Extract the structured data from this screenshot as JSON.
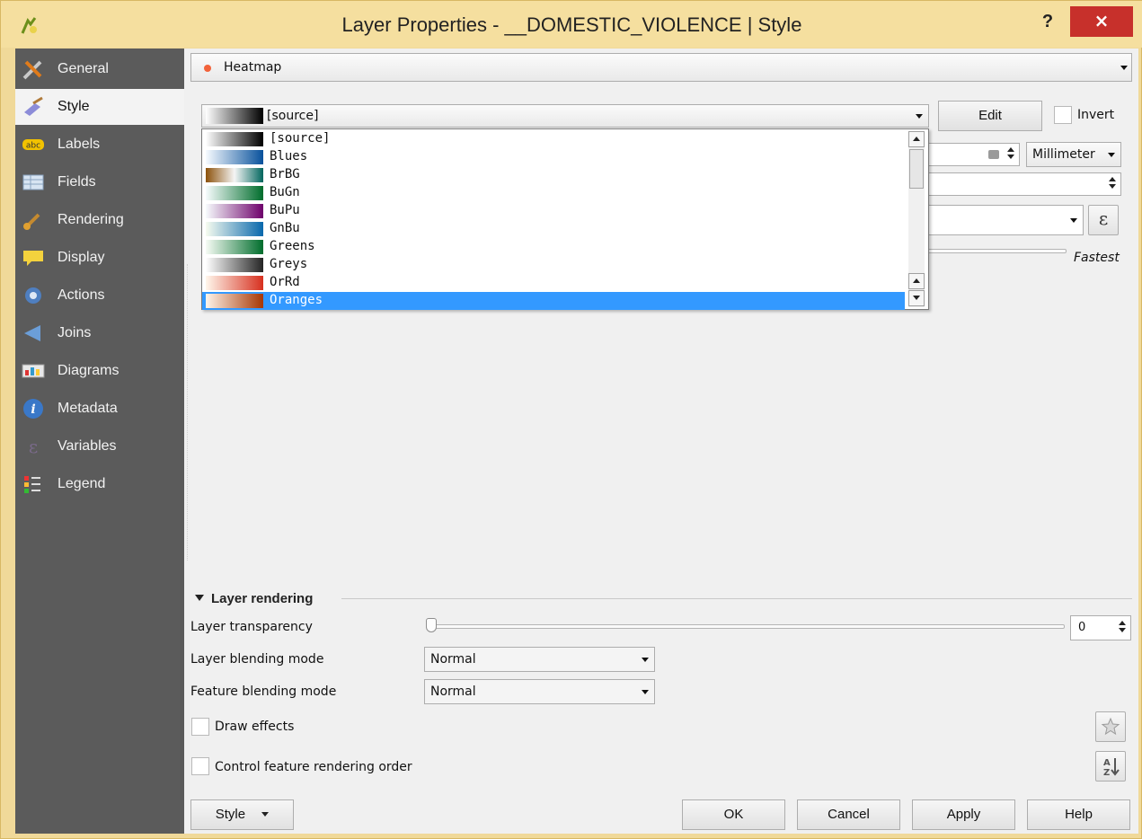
{
  "window": {
    "title": "Layer Properties - __DOMESTIC_VIOLENCE | Style",
    "help_label": "?",
    "close_label": "×",
    "accent": "#c7302b"
  },
  "sidebar": {
    "items": [
      {
        "label": "General",
        "icon": "general-icon"
      },
      {
        "label": "Style",
        "icon": "style-icon",
        "selected": true
      },
      {
        "label": "Labels",
        "icon": "labels-icon"
      },
      {
        "label": "Fields",
        "icon": "fields-icon"
      },
      {
        "label": "Rendering",
        "icon": "rendering-icon"
      },
      {
        "label": "Display",
        "icon": "display-icon"
      },
      {
        "label": "Actions",
        "icon": "actions-icon"
      },
      {
        "label": "Joins",
        "icon": "joins-icon"
      },
      {
        "label": "Diagrams",
        "icon": "diagrams-icon"
      },
      {
        "label": "Metadata",
        "icon": "metadata-icon"
      },
      {
        "label": "Variables",
        "icon": "variables-icon"
      },
      {
        "label": "Legend",
        "icon": "legend-icon"
      }
    ]
  },
  "renderer": {
    "type_label": "Heatmap",
    "color_ramp_value": "[source]",
    "edit_label": "Edit",
    "invert_label": "Invert",
    "unit_value": "Millimeter",
    "expression_symbol": "ε",
    "fastest_label": "Fastest"
  },
  "ramp_list": {
    "items": [
      {
        "label": "[source]",
        "colors": [
          "#ffffff",
          "#000000"
        ]
      },
      {
        "label": "Blues",
        "colors": [
          "#f7fbff",
          "#08519c"
        ]
      },
      {
        "label": "BrBG",
        "colors": [
          "#8c510a",
          "#f5f5f5",
          "#01665e"
        ]
      },
      {
        "label": "BuGn",
        "colors": [
          "#f7fcfd",
          "#006d2c"
        ]
      },
      {
        "label": "BuPu",
        "colors": [
          "#f7fcfd",
          "#6e016b"
        ]
      },
      {
        "label": "GnBu",
        "colors": [
          "#f7fcf0",
          "#0868ac"
        ]
      },
      {
        "label": "Greens",
        "colors": [
          "#f7fcf5",
          "#006d2c"
        ]
      },
      {
        "label": "Greys",
        "colors": [
          "#ffffff",
          "#252525"
        ]
      },
      {
        "label": "OrRd",
        "colors": [
          "#fff7ec",
          "#d7301f"
        ]
      },
      {
        "label": "Oranges",
        "colors": [
          "#fff5eb",
          "#a63603"
        ],
        "selected": true
      }
    ],
    "selection_color": "#3399ff"
  },
  "layer_rendering": {
    "section_label": "Layer rendering",
    "transparency_label": "Layer transparency",
    "transparency_value": "0",
    "layer_blend_label": "Layer blending mode",
    "layer_blend_value": "Normal",
    "feature_blend_label": "Feature blending mode",
    "feature_blend_value": "Normal",
    "draw_effects_label": "Draw effects",
    "control_order_label": "Control feature rendering order"
  },
  "footer": {
    "style_label": "Style",
    "ok_label": "OK",
    "cancel_label": "Cancel",
    "apply_label": "Apply",
    "help_label": "Help"
  }
}
